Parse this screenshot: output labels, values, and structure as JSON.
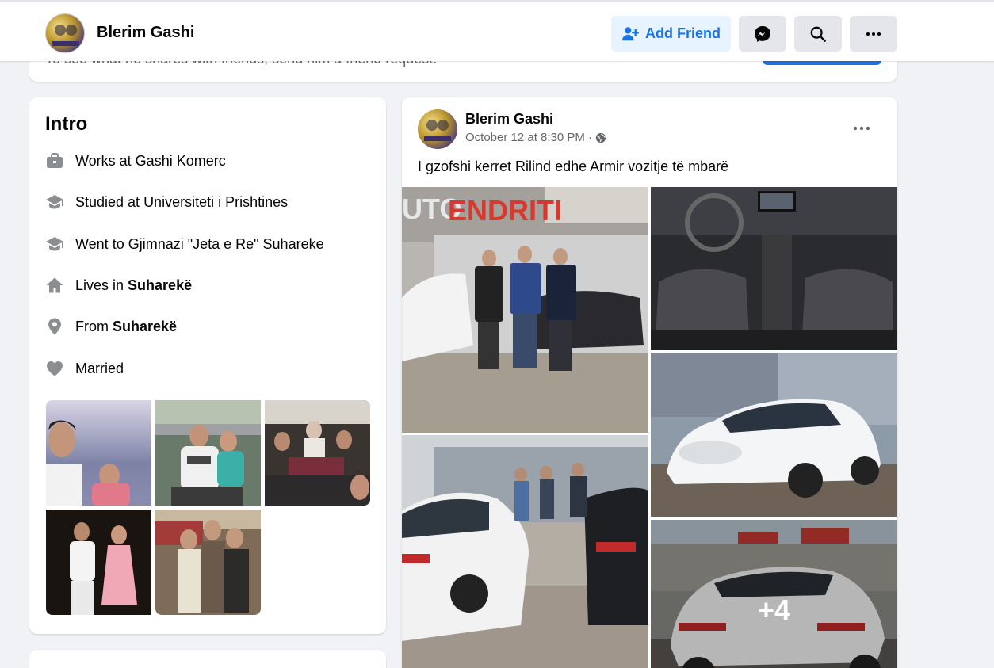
{
  "header": {
    "name": "Blerim Gashi",
    "add_friend_label": "Add Friend",
    "icons": [
      "add-person-icon",
      "messenger-icon",
      "search-icon",
      "more-icon"
    ]
  },
  "friend_request": {
    "text": "To see what he shares with friends, send him a friend request."
  },
  "intro": {
    "title": "Intro",
    "items": [
      {
        "icon": "briefcase-icon",
        "text": "Works at Gashi Komerc",
        "bold": ""
      },
      {
        "icon": "graduation-cap-icon",
        "text": "Studied at Universiteti i Prishtines",
        "bold": ""
      },
      {
        "icon": "graduation-cap-icon",
        "text": "Went to Gjimnazi \"Jeta e Re\" Suhareke",
        "bold": ""
      },
      {
        "icon": "home-icon",
        "text": "Lives in ",
        "bold": "Suharekë"
      },
      {
        "icon": "location-pin-icon",
        "text": "From ",
        "bold": "Suharekë"
      },
      {
        "icon": "heart-icon",
        "text": "Married",
        "bold": ""
      }
    ]
  },
  "post": {
    "author": "Blerim Gashi",
    "time": "October 12 at 8:30 PM",
    "separator": "·",
    "privacy_icon": "globe-icon",
    "text": "I gzofshi kerret Rilind edhe Armir vozitje të  mbarë",
    "more_photos": "+4"
  },
  "colors": {
    "accent": "#1b74e4",
    "accent_light": "#e7f3ff",
    "background": "#f0f2f5",
    "secondary_text": "#65676b",
    "icon_gray": "#8a8d91"
  }
}
